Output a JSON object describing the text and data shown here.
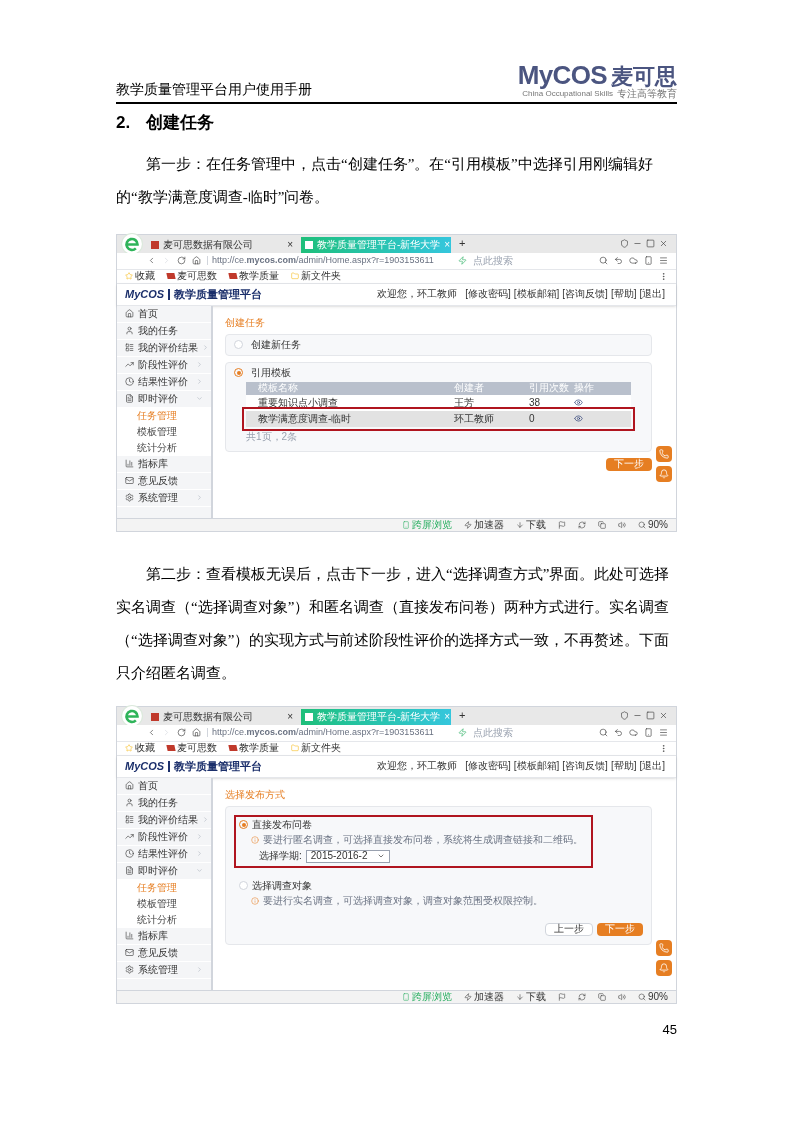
{
  "header": {
    "title": "教学质量管理平台用户使用手册",
    "logo": {
      "brand": "MyCOS",
      "name": "麦可思",
      "tagline_en": "China Occupational Skills",
      "tagline_cn": "专注高等教育"
    }
  },
  "section": {
    "number": "2.",
    "title": "创建任务"
  },
  "blocks": [
    {
      "kind": "paragraph",
      "text": "第一步：在任务管理中，点击“创建任务”。在“引用模板”中选择引用刚编辑好的“教学满意度调查-临时”问卷。"
    },
    {
      "kind": "screenshot",
      "browser": {
        "tabs": [
          {
            "label": "麦可思数据有限公司",
            "selected": false,
            "close": "×"
          },
          {
            "label": "教学质量管理平台-新华大学",
            "selected": true,
            "close": "×"
          }
        ],
        "new_tab": "+",
        "url": "http://ce.**mycos.com**/admin/Home.aspx?r=1903153611",
        "search_placeholder": "点此搜索",
        "bookmarks": [
          {
            "kind": "star",
            "label": "收藏"
          },
          {
            "kind": "site",
            "label": "麦可思数"
          },
          {
            "kind": "site",
            "label": "教学质量"
          },
          {
            "kind": "folder",
            "label": "新文件夹"
          }
        ]
      },
      "app": {
        "brand": "MyCOS",
        "title": "教学质量管理平台",
        "welcome": "欢迎您，环工教师",
        "links": [
          "[修改密码]",
          "[模板邮箱]",
          "[咨询反馈]",
          "[帮助]",
          "[退出]"
        ]
      },
      "sidebar": [
        {
          "kind": "home",
          "label": "首页",
          "has_submenu": false
        },
        {
          "kind": "user",
          "label": "我的任务",
          "has_submenu": false
        },
        {
          "kind": "results",
          "label": "我的评价结果",
          "has_submenu": true,
          "expanded": false
        },
        {
          "kind": "trend",
          "label": "阶段性评价",
          "has_submenu": true,
          "expanded": false
        },
        {
          "kind": "clock",
          "label": "结果性评价",
          "has_submenu": true,
          "expanded": false
        },
        {
          "kind": "file",
          "label": "即时评价",
          "has_submenu": true,
          "expanded": true,
          "children": [
            {
              "label": "任务管理",
              "selected": true
            },
            {
              "label": "模板管理",
              "selected": false
            },
            {
              "label": "统计分析",
              "selected": false
            }
          ]
        },
        {
          "kind": "chart",
          "label": "指标库",
          "has_submenu": false
        },
        {
          "kind": "mail",
          "label": "意见反馈",
          "has_submenu": false
        },
        {
          "kind": "settings",
          "label": "系统管理",
          "has_submenu": true,
          "expanded": false
        }
      ],
      "content": {
        "kind": "separate_cards",
        "title": "创建任务",
        "options": [
          {
            "label": "创建新任务",
            "selected": false
          },
          {
            "label": "引用模板",
            "selected": true,
            "table": {
              "columns": [
                "模板名称",
                "创建者",
                "引用次数",
                "操作"
              ],
              "rows": [
                {
                  "cells": [
                    "重要知识点小调查",
                    "王芳",
                    "38"
                  ],
                  "selected": false,
                  "annotated": false
                },
                {
                  "cells": [
                    "教学满意度调查-临时",
                    "环工教师",
                    "0"
                  ],
                  "selected": true,
                  "annotated": true
                }
              ]
            },
            "pager": "共1页，2条"
          }
        ],
        "buttons": [
          {
            "kind": "primary",
            "label": "下一步"
          }
        ]
      },
      "status_bar": {
        "items": [
          "跨屏浏览",
          "加速器",
          "下载"
        ],
        "zoom": "90%"
      }
    },
    {
      "kind": "paragraph",
      "text": "第二步：查看模板无误后，点击下一步，进入“选择调查方式”界面。此处可选择实名调查（“选择调查对象”）和匿名调查（直接发布问卷）两种方式进行。实名调查（“选择调查对象”）的实现方式与前述阶段性评价的选择方式一致，不再赘述。下面只介绍匿名调查。"
    },
    {
      "kind": "screenshot",
      "browser": {
        "tabs": [
          {
            "label": "麦可思数据有限公司",
            "selected": false,
            "close": "×"
          },
          {
            "label": "教学质量管理平台-新华大学",
            "selected": true,
            "close": "×"
          }
        ],
        "new_tab": "+",
        "url": "http://ce.**mycos.com**/admin/Home.aspx?r=1903153611",
        "search_placeholder": "点此搜索",
        "bookmarks": [
          {
            "kind": "star",
            "label": "收藏"
          },
          {
            "kind": "site",
            "label": "麦可思数"
          },
          {
            "kind": "site",
            "label": "教学质量"
          },
          {
            "kind": "folder",
            "label": "新文件夹"
          }
        ]
      },
      "app": {
        "brand": "MyCOS",
        "title": "教学质量管理平台",
        "welcome": "欢迎您，环工教师",
        "links": [
          "[修改密码]",
          "[模板邮箱]",
          "[咨询反馈]",
          "[帮助]",
          "[退出]"
        ]
      },
      "sidebar": [
        {
          "kind": "home",
          "label": "首页",
          "has_submenu": false
        },
        {
          "kind": "user",
          "label": "我的任务",
          "has_submenu": false
        },
        {
          "kind": "results",
          "label": "我的评价结果",
          "has_submenu": true,
          "expanded": false
        },
        {
          "kind": "trend",
          "label": "阶段性评价",
          "has_submenu": true,
          "expanded": false
        },
        {
          "kind": "clock",
          "label": "结果性评价",
          "has_submenu": true,
          "expanded": false
        },
        {
          "kind": "file",
          "label": "即时评价",
          "has_submenu": true,
          "expanded": true,
          "children": [
            {
              "label": "任务管理",
              "selected": true
            },
            {
              "label": "模板管理",
              "selected": false
            },
            {
              "label": "统计分析",
              "selected": false
            }
          ]
        },
        {
          "kind": "chart",
          "label": "指标库",
          "has_submenu": false
        },
        {
          "kind": "mail",
          "label": "意见反馈",
          "has_submenu": false
        },
        {
          "kind": "settings",
          "label": "系统管理",
          "has_submenu": true,
          "expanded": false
        }
      ],
      "content": {
        "kind": "single_card",
        "title": "选择发布方式",
        "options": [
          {
            "label": "直接发布问卷",
            "selected": true,
            "annotated": true,
            "hint": "要进行匿名调查，可选择直接发布问卷，系统将生成调查链接和二维码。",
            "field": {
              "label": "选择学期:",
              "value": "2015-2016-2"
            }
          },
          {
            "label": "选择调查对象",
            "selected": false,
            "annotated": false,
            "hint": "要进行实名调查，可选择调查对象，调查对象范围受权限控制。"
          }
        ],
        "buttons": [
          {
            "kind": "secondary",
            "label": "上一步"
          },
          {
            "kind": "primary",
            "label": "下一步"
          }
        ]
      },
      "status_bar": {
        "items": [
          "跨屏浏览",
          "加速器",
          "下载"
        ],
        "zoom": "90%"
      }
    }
  ],
  "page_number": "45"
}
